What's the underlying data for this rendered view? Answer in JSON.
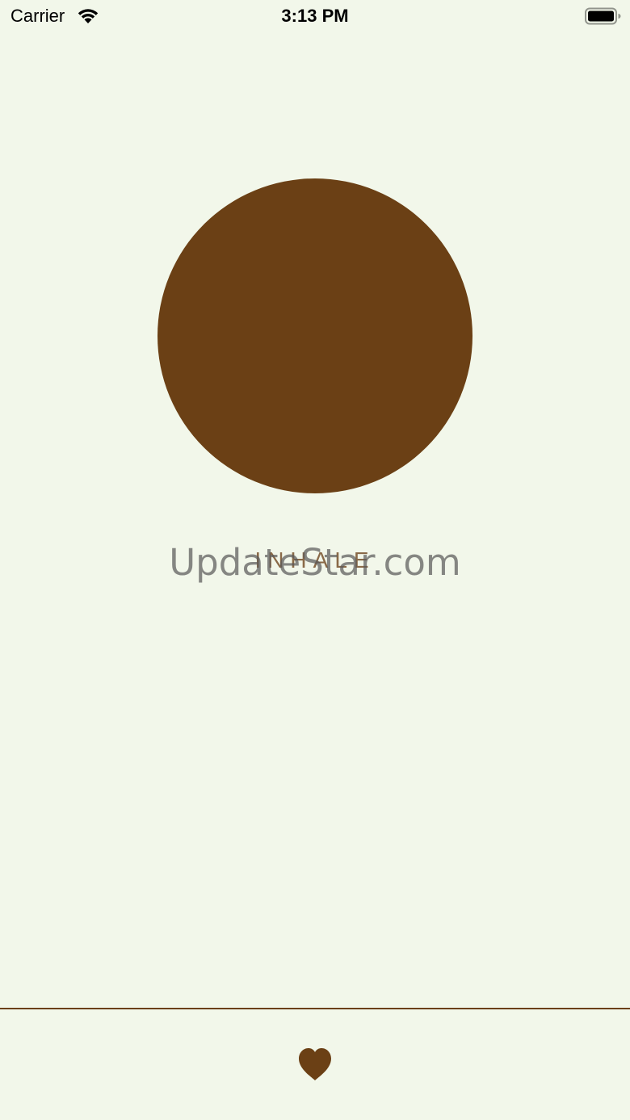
{
  "status_bar": {
    "carrier": "Carrier",
    "time": "3:13 PM",
    "icons": [
      "wifi-icon",
      "battery-icon"
    ]
  },
  "breath": {
    "phase": "INHALE",
    "circle_color": "#6b4015"
  },
  "watermark": {
    "text": "UpdateStar.com"
  },
  "tab_bar": {
    "icon": "heart-icon",
    "accent_color": "#6b4015"
  },
  "colors": {
    "background": "#f2f7ea",
    "accent": "#6b4015",
    "label": "#8a6a48"
  }
}
